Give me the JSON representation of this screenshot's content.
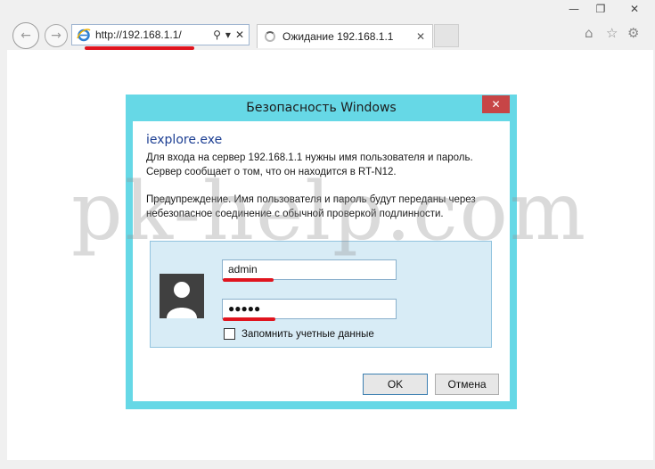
{
  "browser": {
    "address_url": "http://192.168.1.1/",
    "tab_title": "Ожидание 192.168.1.1"
  },
  "dialog": {
    "title": "Безопасность Windows",
    "app_name": "iexplore.exe",
    "line1": "Для входа на сервер 192.168.1.1 нужны имя пользователя и пароль.",
    "line2": "Сервер сообщает о том, что он находится в RT-N12.",
    "warning1": "Предупреждение. Имя пользователя и пароль будут переданы через",
    "warning2": "небезопасное соединение с обычной проверкой подлинности.",
    "username_value": "admin",
    "password_value": "●●●●●",
    "remember_label": "Запомнить учетные данные",
    "ok_label": "OK",
    "cancel_label": "Отмена"
  },
  "watermark": "pk-help.com",
  "colors": {
    "dialog_frame": "#66d8e6",
    "close_button": "#c74546",
    "credential_panel": "#d8ecf6",
    "highlight_mark": "#e0141e"
  }
}
